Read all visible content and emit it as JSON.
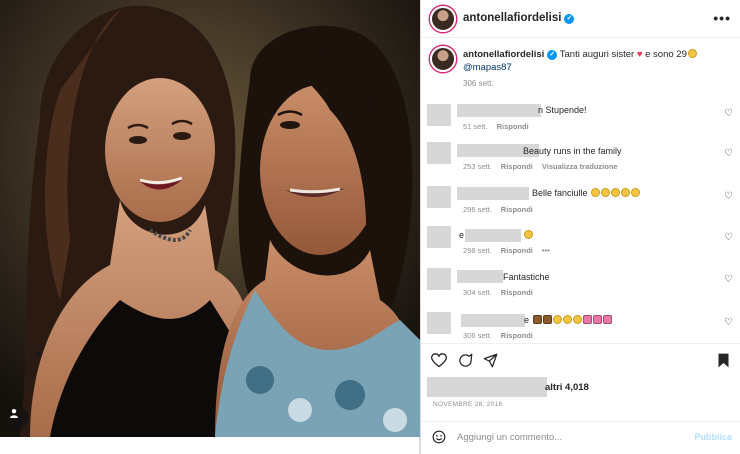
{
  "photo": {
    "tag_icon": "user-tag-icon"
  },
  "header": {
    "username": "antonellafiordelisi",
    "verified_icon": "verified-badge-icon",
    "more_icon": "more-options-icon",
    "more_glyph": "•••"
  },
  "caption": {
    "username": "antonellafiordelisi",
    "text": "Tanti auguri sister",
    "text_after_heart": " e sono 29",
    "heart_glyph": "♥",
    "mention": "@mapas87",
    "time": "306 sett."
  },
  "comments": [
    {
      "text": "n Stupende!",
      "time": "51 sett.",
      "reply": "Rispondi",
      "translate": "",
      "more": "",
      "emojis": 0
    },
    {
      "text": "Beauty runs in the family",
      "time": "253 sett.",
      "reply": "Rispondi",
      "translate": "Visualizza traduzione",
      "more": "",
      "emojis": 0
    },
    {
      "text": "Belle fanciulle",
      "time": "296 sett.",
      "reply": "Rispondi",
      "translate": "",
      "more": "",
      "emojis": 5
    },
    {
      "text": "e",
      "time": "298 sett.",
      "reply": "Rispondi",
      "translate": "",
      "more": "•••",
      "emojis": 1
    },
    {
      "text": "Fantastiche",
      "time": "304 sett.",
      "reply": "Rispondi",
      "translate": "",
      "more": "",
      "emojis": 0
    },
    {
      "text": "e",
      "time": "306 sett.",
      "reply": "Rispondi",
      "translate": "",
      "more": "",
      "emojis": 8
    }
  ],
  "actions": {
    "like_icon": "heart-icon",
    "comment_icon": "comment-icon",
    "share_icon": "share-icon",
    "save_icon": "bookmark-icon"
  },
  "likes": {
    "text": "altri 4,018"
  },
  "post_date": "NOVEMBRE 28, 2016",
  "add_comment": {
    "emoji_icon": "emoji-icon",
    "placeholder": "Aggiungi un commento...",
    "publish": "Pubblica"
  },
  "colors": {
    "verified": "#0095f6",
    "link": "#00376b",
    "muted": "#8e8e8e",
    "publish_disabled": "#b2dffc",
    "heart_red": "#ed2d4b"
  }
}
